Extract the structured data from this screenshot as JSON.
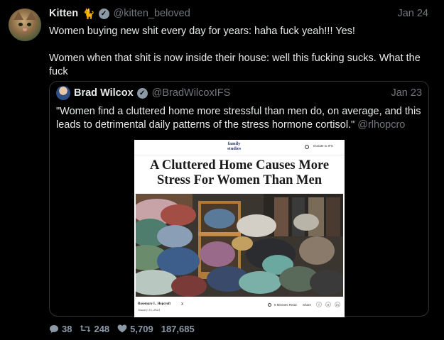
{
  "tweet": {
    "author_name": "Kitten",
    "author_emoji": "🐈",
    "handle": "@kitten_beloved",
    "date": "Jan 24",
    "text_line1": "Women buying new shit every day for years: haha fuck yeah!!! Yes!",
    "text_line2": "Women when that shit is now inside their house: well this fucking sucks. What the fuck"
  },
  "quote": {
    "author_name": "Brad Wilcox",
    "handle": "@BradWilcoxIFS",
    "date": "Jan 23",
    "text": "\"Women find a cluttered home more stressful than men do, on average, and this leads to detrimental daily patterns of the stress hormone cortisol.\"",
    "mention": "@rlhopcro",
    "article": {
      "logo_line1": "family",
      "logo_line2": "studies",
      "donate": "Donate to IFS",
      "title": "A Cluttered Home Causes More Stress For Women Than Men",
      "author": "Rosemary L. Hopcroft",
      "author_x": "X",
      "pub_date": "January 23, 2024",
      "read_time": "6 Minutes Read",
      "share": "Share",
      "social": [
        "f",
        "X",
        "in"
      ]
    }
  },
  "metrics": {
    "replies": "38",
    "retweets": "248",
    "likes": "5,709",
    "views": "187,685"
  },
  "colors": {
    "background": "#000000",
    "text": "#e7e9ea",
    "muted": "#71767b",
    "border": "#2f3336"
  }
}
